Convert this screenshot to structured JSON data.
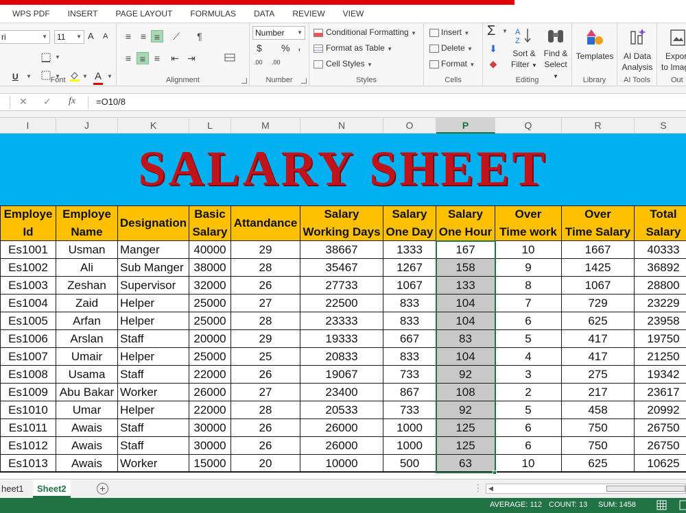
{
  "ribbon_tabs": [
    "WPS PDF",
    "INSERT",
    "PAGE LAYOUT",
    "FORMULAS",
    "DATA",
    "REVIEW",
    "VIEW"
  ],
  "ribbon": {
    "font": {
      "name": "ri",
      "size": "11",
      "grow": "A",
      "shrink": "A",
      "underline": "U",
      "font_color_letter": "A",
      "label": "Font"
    },
    "alignment": {
      "label": "Alignment"
    },
    "number": {
      "format": "Number",
      "dollar": "$",
      "percent": "%",
      "comma": ",",
      "dec_inc": ".00",
      "dec_dec": ".00",
      "label": "Number"
    },
    "styles": {
      "conditional": "Conditional Formatting",
      "format_table": "Format as Table",
      "cell_styles": "Cell Styles",
      "label": "Styles"
    },
    "cells": {
      "insert": "Insert",
      "delete": "Delete",
      "format": "Format",
      "label": "Cells"
    },
    "editing": {
      "sort_filter_1": "Sort &",
      "sort_filter_2": "Filter",
      "find_select_1": "Find &",
      "find_select_2": "Select",
      "label": "Editing"
    },
    "library": {
      "templates": "Templates",
      "label": "Library"
    },
    "ai_tools": {
      "ai_data_1": "AI Data",
      "ai_data_2": "Analysis",
      "label": "AI Tools"
    },
    "output": {
      "export_1": "Expor",
      "export_2": "to Imag",
      "label": "Out"
    }
  },
  "formula_bar": {
    "name_box": "",
    "cancel": "✕",
    "enter": "✓",
    "fx": "fx",
    "formula": "=O10/8"
  },
  "columns": [
    "I",
    "J",
    "K",
    "L",
    "M",
    "N",
    "O",
    "P",
    "Q",
    "R",
    "S"
  ],
  "selected_column": "P",
  "banner_title": "SALARY SHEET",
  "table": {
    "headers": [
      [
        "Employe",
        "Id"
      ],
      [
        "Employe",
        "Name"
      ],
      [
        "Designation"
      ],
      [
        "Basic",
        "Salary"
      ],
      [
        "Attandance"
      ],
      [
        "Salary",
        "Working Days"
      ],
      [
        "Salary",
        "One Day"
      ],
      [
        "Salary",
        "One Hour"
      ],
      [
        "Over",
        "Time work"
      ],
      [
        "Over",
        "Time Salary"
      ],
      [
        "Total",
        "Salary"
      ]
    ],
    "rows": [
      [
        "Es1001",
        "Usman",
        "Manger",
        "40000",
        "29",
        "38667",
        "1333",
        "167",
        "10",
        "1667",
        "40333"
      ],
      [
        "Es1002",
        "Ali",
        "Sub Manger",
        "38000",
        "28",
        "35467",
        "1267",
        "158",
        "9",
        "1425",
        "36892"
      ],
      [
        "Es1003",
        "Zeshan",
        "Supervisor",
        "32000",
        "26",
        "27733",
        "1067",
        "133",
        "8",
        "1067",
        "28800"
      ],
      [
        "Es1004",
        "Zaid",
        "Helper",
        "25000",
        "27",
        "22500",
        "833",
        "104",
        "7",
        "729",
        "23229"
      ],
      [
        "Es1005",
        "Arfan",
        "Helper",
        "25000",
        "28",
        "23333",
        "833",
        "104",
        "6",
        "625",
        "23958"
      ],
      [
        "Es1006",
        "Arslan",
        "Staff",
        "20000",
        "29",
        "19333",
        "667",
        "83",
        "5",
        "417",
        "19750"
      ],
      [
        "Es1007",
        "Umair",
        "Helper",
        "25000",
        "25",
        "20833",
        "833",
        "104",
        "4",
        "417",
        "21250"
      ],
      [
        "Es1008",
        "Usama",
        "Staff",
        "22000",
        "26",
        "19067",
        "733",
        "92",
        "3",
        "275",
        "19342"
      ],
      [
        "Es1009",
        "Abu Bakar",
        "Worker",
        "26000",
        "27",
        "23400",
        "867",
        "108",
        "2",
        "217",
        "23617"
      ],
      [
        "Es1010",
        "Umar",
        "Helper",
        "22000",
        "28",
        "20533",
        "733",
        "92",
        "5",
        "458",
        "20992"
      ],
      [
        "Es1011",
        "Awais",
        "Staff",
        "30000",
        "26",
        "26000",
        "1000",
        "125",
        "6",
        "750",
        "26750"
      ],
      [
        "Es1012",
        "Awais",
        "Staff",
        "30000",
        "26",
        "26000",
        "1000",
        "125",
        "6",
        "750",
        "26750"
      ],
      [
        "Es1013",
        "Awais",
        "Worker",
        "15000",
        "20",
        "10000",
        "500",
        "63",
        "10",
        "625",
        "10625"
      ]
    ]
  },
  "sheet_tabs": [
    {
      "label": "heet1",
      "active": false
    },
    {
      "label": "Sheet2",
      "active": true
    }
  ],
  "status": {
    "average": "AVERAGE: 112",
    "count": "COUNT: 13",
    "sum": "SUM: 1458"
  },
  "colors": {
    "excel_green": "#217346",
    "header_fill": "#ffc000",
    "banner_fill": "#00b0f0",
    "title_red": "#c0141c",
    "selection_fill": "#c8c8c8"
  }
}
